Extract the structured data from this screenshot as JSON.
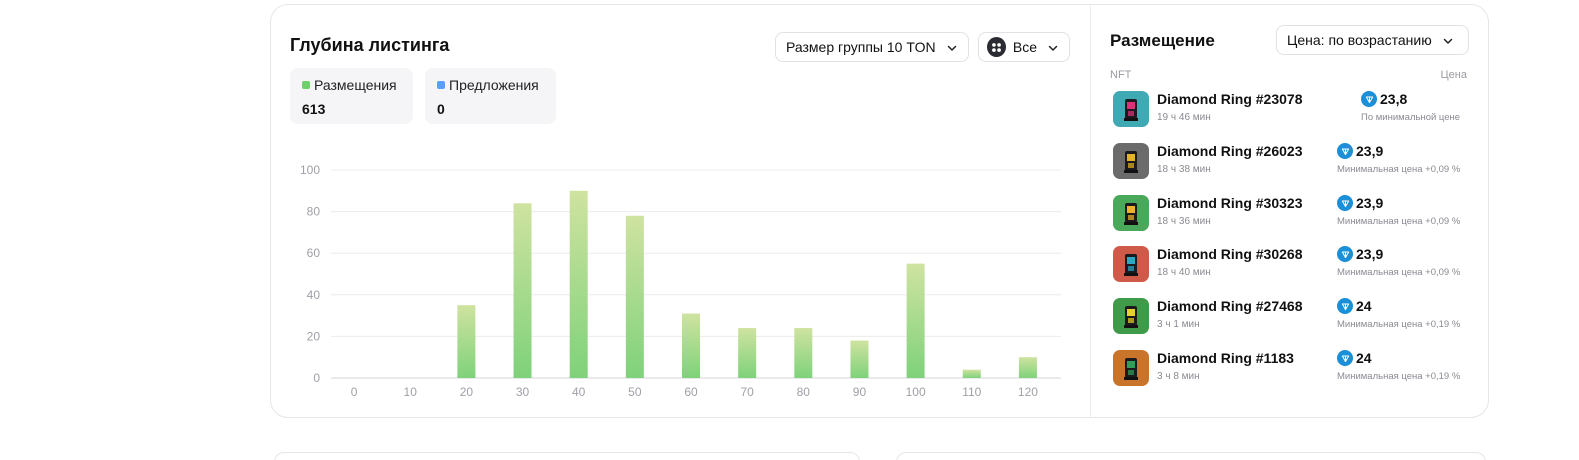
{
  "listing_depth": {
    "title": "Глубина листинга",
    "group_size_label": "Размер группы 10 TON",
    "filter_label": "Все",
    "stats": [
      {
        "label": "Размещения",
        "value": "613",
        "color": "#6fd16a"
      },
      {
        "label": "Предложения",
        "value": "0",
        "color": "#5b9ff5"
      }
    ]
  },
  "chart_data": {
    "type": "bar",
    "categories": [
      "0",
      "10",
      "20",
      "30",
      "40",
      "50",
      "60",
      "70",
      "80",
      "90",
      "100",
      "110",
      "120"
    ],
    "series": [
      {
        "values": [
          0,
          0,
          35,
          84,
          90,
          78,
          31,
          24,
          24,
          18,
          55,
          4,
          10
        ],
        "color": "#8fd67e"
      }
    ],
    "y_ticks": [
      "0",
      "20",
      "40",
      "60",
      "80",
      "100"
    ],
    "ylim": [
      0,
      100
    ],
    "grid": true,
    "xlabel": "",
    "ylabel": ""
  },
  "placement": {
    "title": "Размещение",
    "sort_label": "Цена: по возрастанию",
    "col_nft": "NFT",
    "col_price": "Цена",
    "items": [
      {
        "name": "Diamond Ring #23078",
        "time": "19 ч 46 мин",
        "price": "23,8",
        "note": "По минимальной цене",
        "bg": "#3fa9b4",
        "figure": "#e0307a"
      },
      {
        "name": "Diamond Ring #26023",
        "time": "18 ч 38 мин",
        "price": "23,9",
        "note": "Минимальная цена +0,09 %",
        "bg": "#6b6b6b",
        "figure": "#e6b422"
      },
      {
        "name": "Diamond Ring #30323",
        "time": "18 ч 36 мин",
        "price": "23,9",
        "note": "Минимальная цена +0,09 %",
        "bg": "#4aa85a",
        "figure": "#f0b12a"
      },
      {
        "name": "Diamond Ring #30268",
        "time": "18 ч 40 мин",
        "price": "23,9",
        "note": "Минимальная цена +0,09 %",
        "bg": "#d05a4a",
        "figure": "#2aa8c4"
      },
      {
        "name": "Diamond Ring #27468",
        "time": "3 ч 1 мин",
        "price": "24",
        "note": "Минимальная цена +0,19 %",
        "bg": "#3f9a4a",
        "figure": "#e6d22a"
      },
      {
        "name": "Diamond Ring #1183",
        "time": "3 ч 8 мин",
        "price": "24",
        "note": "Минимальная цена +0,19 %",
        "bg": "#c8742a",
        "figure": "#2fa05a"
      }
    ]
  },
  "icons": {
    "chevron": "chevron-down-icon",
    "grid": "grid-icon",
    "ton": "ton-icon"
  }
}
